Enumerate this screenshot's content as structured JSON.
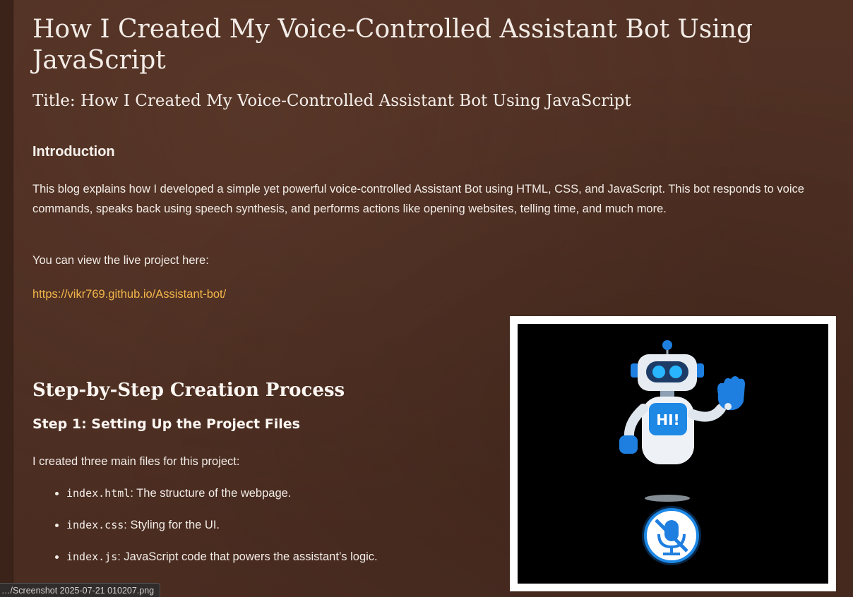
{
  "post": {
    "title": "How I Created My Voice-Controlled Assistant Bot Using JavaScript",
    "subtitle": "Title: How I Created My Voice-Controlled Assistant Bot Using JavaScript",
    "intro_heading": "Introduction",
    "intro_paragraph": "This blog explains how I developed a simple yet powerful voice-controlled Assistant Bot using HTML, CSS, and JavaScript. This bot responds to voice commands, speaks back using speech synthesis, and performs actions like opening websites, telling time, and much more.",
    "live_text": "You can view the live project here:",
    "live_link": "https://vikr769.github.io/Assistant-bot/",
    "steps_heading": "Step-by-Step Creation Process",
    "step1_heading": "Step 1: Setting Up the Project Files",
    "step1_text": "I created three main files for this project:",
    "files": [
      {
        "name": "index.html",
        "desc": ": The structure of the webpage."
      },
      {
        "name": "index.css",
        "desc": ": Styling for the UI."
      },
      {
        "name": "index.js",
        "desc": ": JavaScript code that powers the assistant’s logic."
      }
    ]
  },
  "image": {
    "badge_text": "HI!",
    "icons": [
      "robot-icon",
      "mic-off-icon"
    ]
  },
  "status_bar": {
    "path": "…/Screenshot 2025-07-21 010207.png"
  },
  "colors": {
    "background": "#4d2e22",
    "link": "#f3b54a",
    "text": "#f2ece7"
  }
}
